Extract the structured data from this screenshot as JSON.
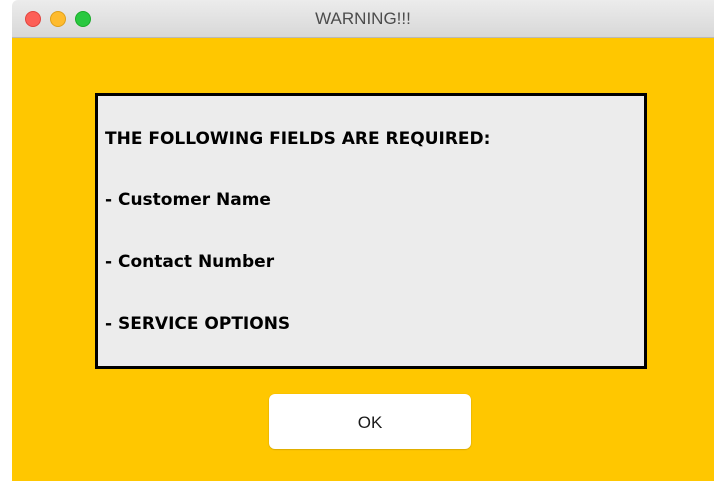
{
  "window": {
    "title": "WARNING!!!"
  },
  "message": {
    "heading": "THE FOLLOWING FIELDS ARE REQUIRED:",
    "items": [
      "-  Customer Name",
      "-  Contact Number",
      "-  SERVICE OPTIONS"
    ]
  },
  "buttons": {
    "ok_label": "OK"
  },
  "colors": {
    "background": "#ffc700",
    "message_box": "#ececec",
    "close": "#fd5f57",
    "minimize": "#febb2e",
    "zoom": "#29c840"
  }
}
